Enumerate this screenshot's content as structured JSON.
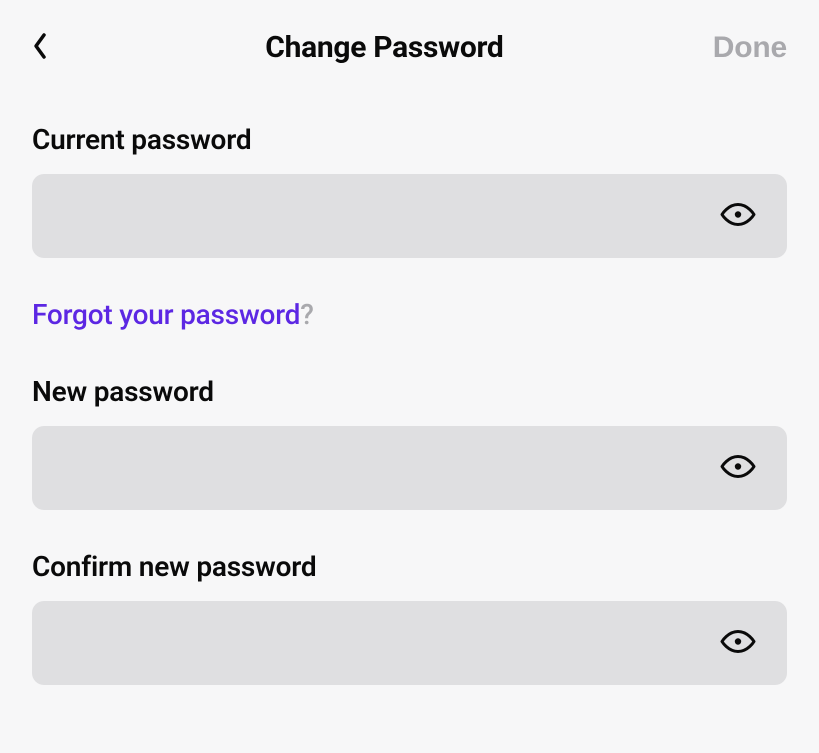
{
  "header": {
    "title": "Change Password",
    "done_label": "Done"
  },
  "fields": {
    "current": {
      "label": "Current password",
      "value": ""
    },
    "new": {
      "label": "New password",
      "value": ""
    },
    "confirm": {
      "label": "Confirm new password",
      "value": ""
    }
  },
  "forgot": {
    "link_text": "Forgot your password",
    "qmark": "?"
  }
}
